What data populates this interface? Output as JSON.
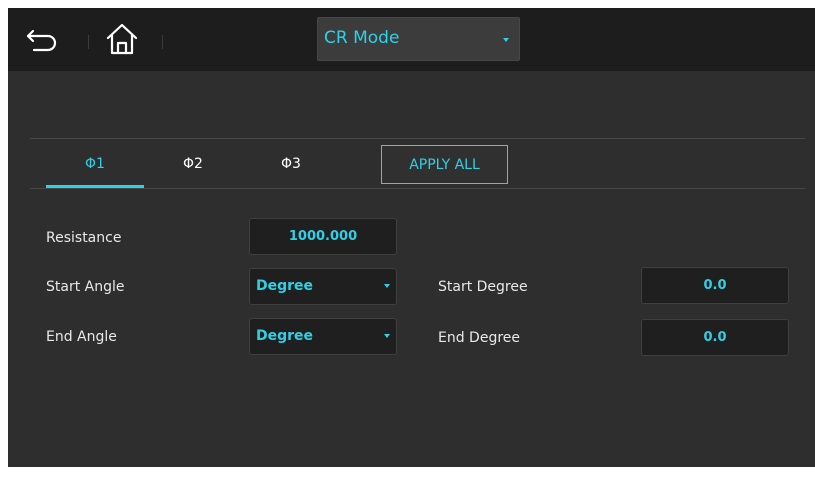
{
  "header": {
    "back_icon": "back-arrow-icon",
    "home_icon": "home-icon",
    "mode": {
      "selected": "CR Mode"
    }
  },
  "tabs": [
    {
      "label": "Φ1",
      "active": true
    },
    {
      "label": "Φ2",
      "active": false
    },
    {
      "label": "Φ3",
      "active": false
    }
  ],
  "apply_all_label": "APPLY ALL",
  "form": {
    "resistance": {
      "label": "Resistance",
      "value": "1000.000"
    },
    "start_angle": {
      "label": "Start Angle",
      "unit": "Degree"
    },
    "end_angle": {
      "label": "End Angle",
      "unit": "Degree"
    },
    "start_degree": {
      "label": "Start Degree",
      "value": "0.0"
    },
    "end_degree": {
      "label": "End Degree",
      "value": "0.0"
    }
  },
  "colors": {
    "accent": "#2ed1e6",
    "background": "#2e2e2e",
    "header_background": "#1d1d1d",
    "field_background": "#1f1f1f"
  }
}
